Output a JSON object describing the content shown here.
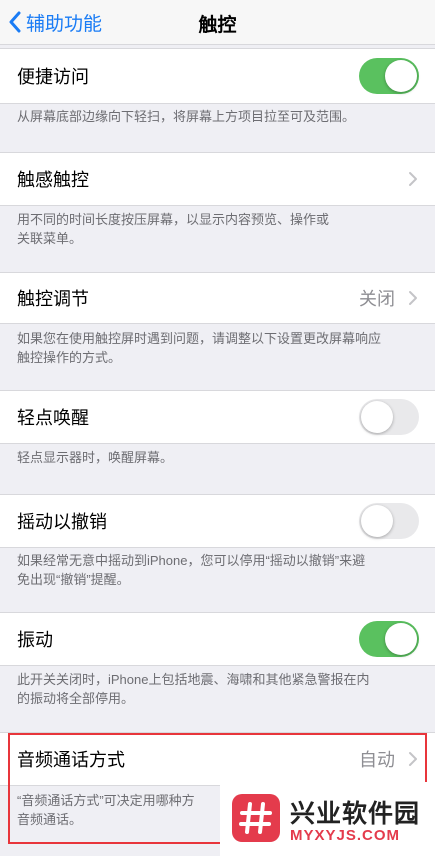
{
  "nav": {
    "back_label": "辅助功能",
    "title": "触控"
  },
  "rows": [
    {
      "label": "便捷访问",
      "control": "toggle",
      "state": "on",
      "footer": "从屏幕底部边缘向下轻扫，将屏幕上方项目拉至可及范围。"
    },
    {
      "label": "触感触控",
      "control": "chevron",
      "footer_lines": [
        "用不同的时间长度按压屏幕，以显示内容预览、操作或",
        "关联菜单。"
      ]
    },
    {
      "label": "触控调节",
      "control": "chevron",
      "value": "关闭",
      "footer_lines": [
        "如果您在使用触控屏时遇到问题，请调整以下设置更改屏幕响应",
        "触控操作的方式。"
      ]
    },
    {
      "label": "轻点唤醒",
      "control": "toggle",
      "state": "off",
      "footer": "轻点显示器时，唤醒屏幕。"
    },
    {
      "label": "摇动以撤销",
      "control": "toggle",
      "state": "off",
      "footer_lines": [
        "如果经常无意中摇动到iPhone，您可以停用“摇动以撤销”来避",
        "免出现“撤销”提醒。"
      ]
    },
    {
      "label": "振动",
      "control": "toggle",
      "state": "on",
      "footer_lines": [
        "此开关关闭时，iPhone上包括地震、海啸和其他紧急警报在内",
        "的振动将全部停用。"
      ]
    },
    {
      "label": "音频通话方式",
      "control": "chevron",
      "value": "自动",
      "footer_lines": [
        "“音频通话方式”可决定用哪种方",
        "音频通话。"
      ]
    }
  ],
  "watermark": {
    "title": "兴业软件园",
    "url": "MYXYJS.COM"
  },
  "colors": {
    "accent": "#1a7cf5",
    "toggle_on": "#5ac15f",
    "toggle_off": "#e9e9eb",
    "highlight": "#e8353b",
    "watermark": "#e43b4c"
  }
}
